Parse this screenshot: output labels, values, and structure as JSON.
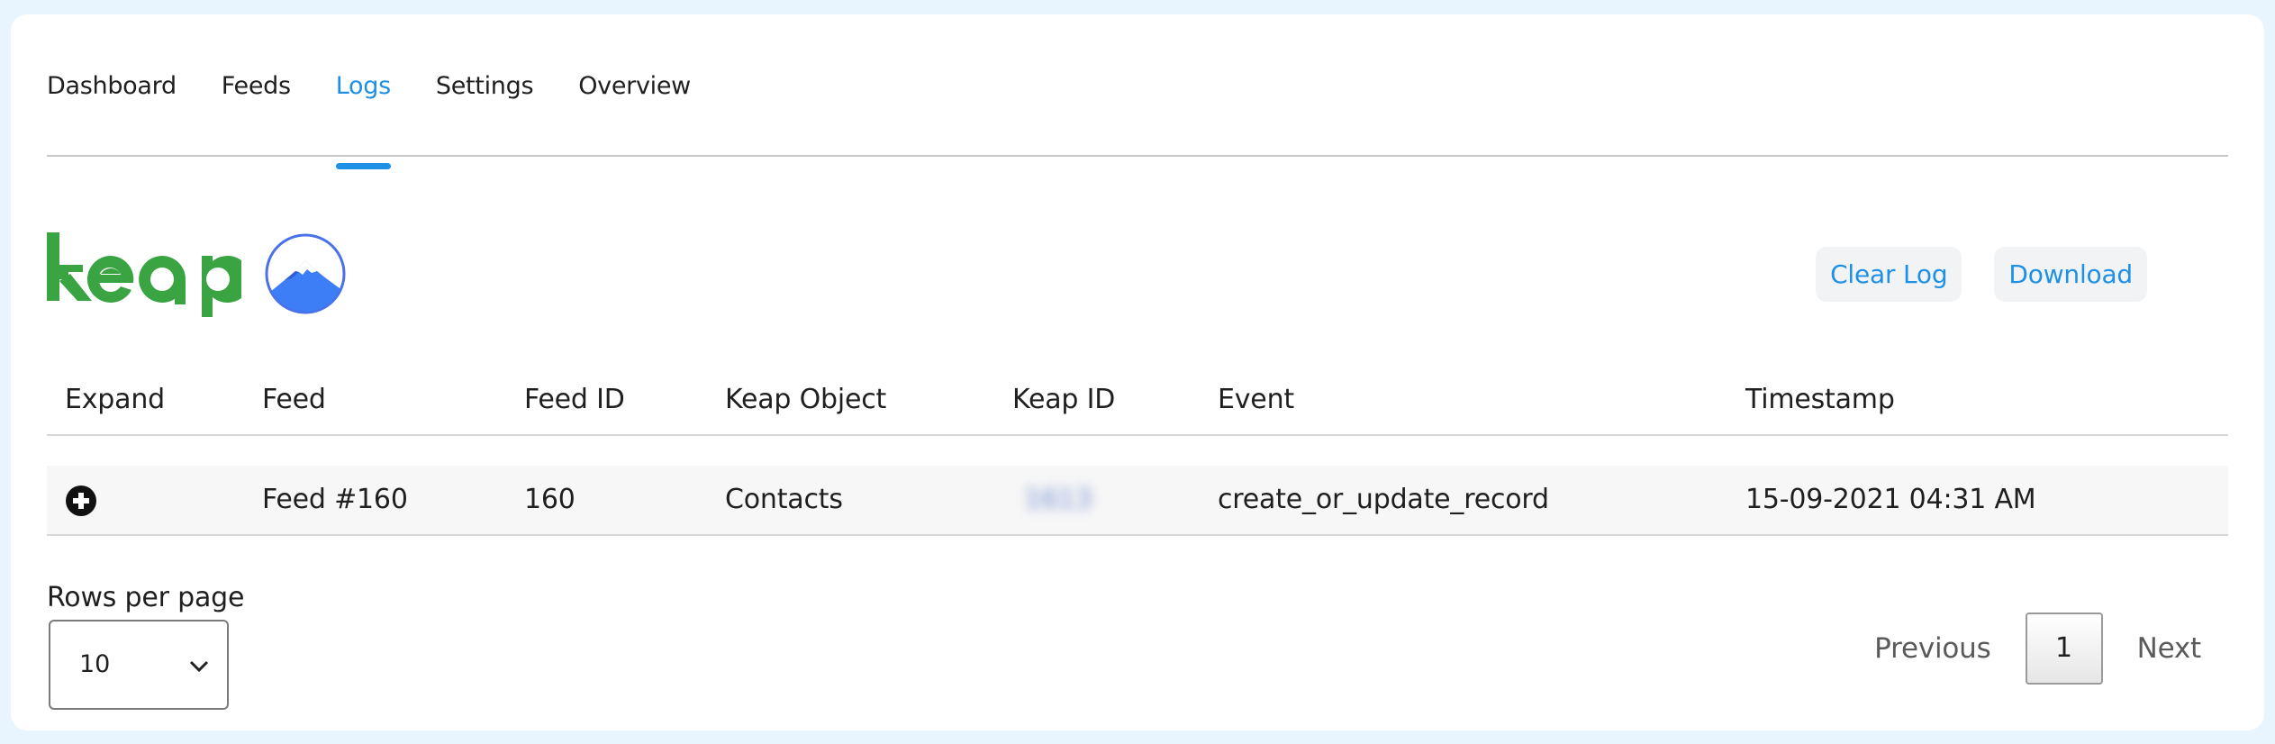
{
  "tabs": [
    {
      "label": "Dashboard",
      "active": false
    },
    {
      "label": "Feeds",
      "active": false
    },
    {
      "label": "Logs",
      "active": true
    },
    {
      "label": "Settings",
      "active": false
    },
    {
      "label": "Overview",
      "active": false
    }
  ],
  "brand": {
    "logo_text": "keap",
    "logo_color": "#3aa443",
    "secondary_icon": "mountain-icon",
    "secondary_color": "#3d7df5"
  },
  "actions": {
    "clear_log": "Clear Log",
    "download": "Download"
  },
  "table": {
    "headers": [
      "Expand",
      "Feed",
      "Feed ID",
      "Keap Object",
      "Keap ID",
      "Event",
      "Timestamp"
    ],
    "rows": [
      {
        "expand_icon": "plus-circle-icon",
        "feed": "Feed #160",
        "feed_id": "160",
        "keap_object": "Contacts",
        "keap_id": "1613",
        "event": "create_or_update_record",
        "timestamp": "15-09-2021 04:31 AM"
      }
    ]
  },
  "pagination": {
    "rows_per_page_label": "Rows per page",
    "rows_per_page_value": "10",
    "previous": "Previous",
    "current_page": "1",
    "next": "Next"
  },
  "colors": {
    "accent": "#1e90e6",
    "page_background": "#e8f4fe"
  }
}
